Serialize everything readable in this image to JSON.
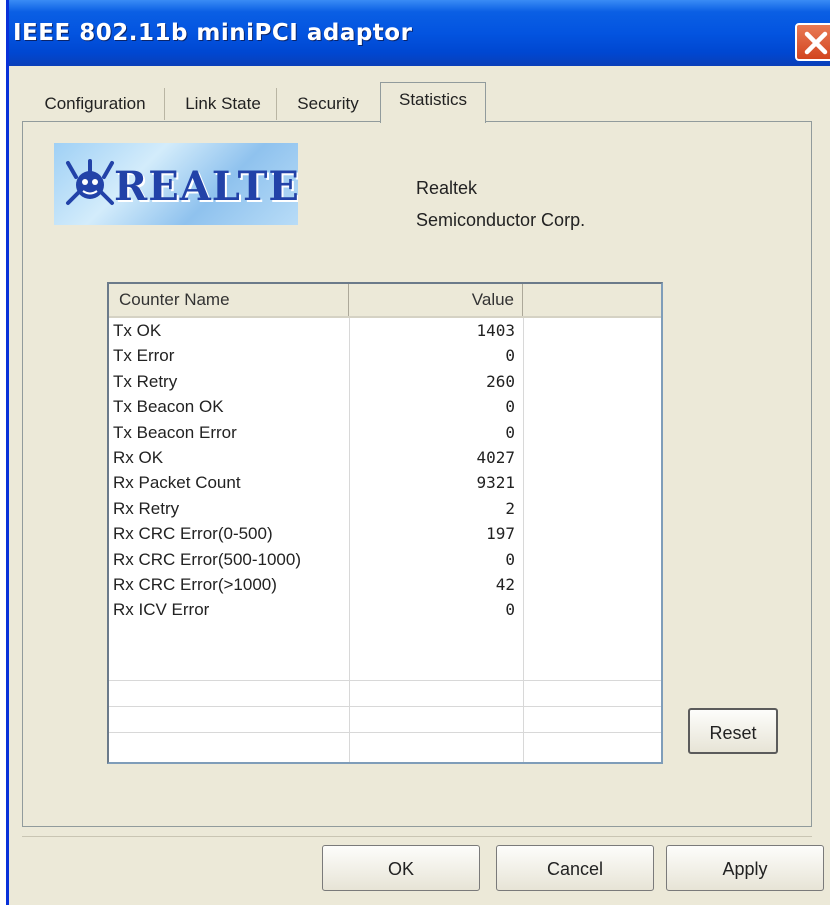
{
  "window": {
    "title": "IEEE 802.11b miniPCI adaptor"
  },
  "tabs": [
    {
      "label": "Configuration",
      "active": false
    },
    {
      "label": "Link State",
      "active": false
    },
    {
      "label": "Security",
      "active": false
    },
    {
      "label": "Statistics",
      "active": true
    }
  ],
  "logo": {
    "text": "REALTEK"
  },
  "company": {
    "line1": "Realtek",
    "line2": "Semiconductor Corp."
  },
  "table": {
    "headers": {
      "name": "Counter Name",
      "value": "Value"
    },
    "rows": [
      {
        "name": "Tx OK",
        "value": "1403"
      },
      {
        "name": "Tx Error",
        "value": "0"
      },
      {
        "name": "Tx Retry",
        "value": "260"
      },
      {
        "name": "Tx Beacon OK",
        "value": "0"
      },
      {
        "name": "Tx Beacon Error",
        "value": "0"
      },
      {
        "name": "Rx OK",
        "value": "4027"
      },
      {
        "name": "Rx Packet Count",
        "value": "9321"
      },
      {
        "name": "Rx Retry",
        "value": "2"
      },
      {
        "name": "Rx CRC Error(0-500)",
        "value": "197"
      },
      {
        "name": "Rx CRC Error(500-1000)",
        "value": "0"
      },
      {
        "name": "Rx CRC Error(>1000)",
        "value": "42"
      },
      {
        "name": "Rx ICV Error",
        "value": "0"
      }
    ]
  },
  "buttons": {
    "reset": "Reset",
    "ok": "OK",
    "cancel": "Cancel",
    "apply": "Apply"
  },
  "icons": {
    "close": "close-icon",
    "logo": "realtek-crab-logo"
  },
  "colors": {
    "titlebar": "#0354e0",
    "close": "#d2451f",
    "dialog": "#ece9d8",
    "logo_text": "#2242a8"
  }
}
